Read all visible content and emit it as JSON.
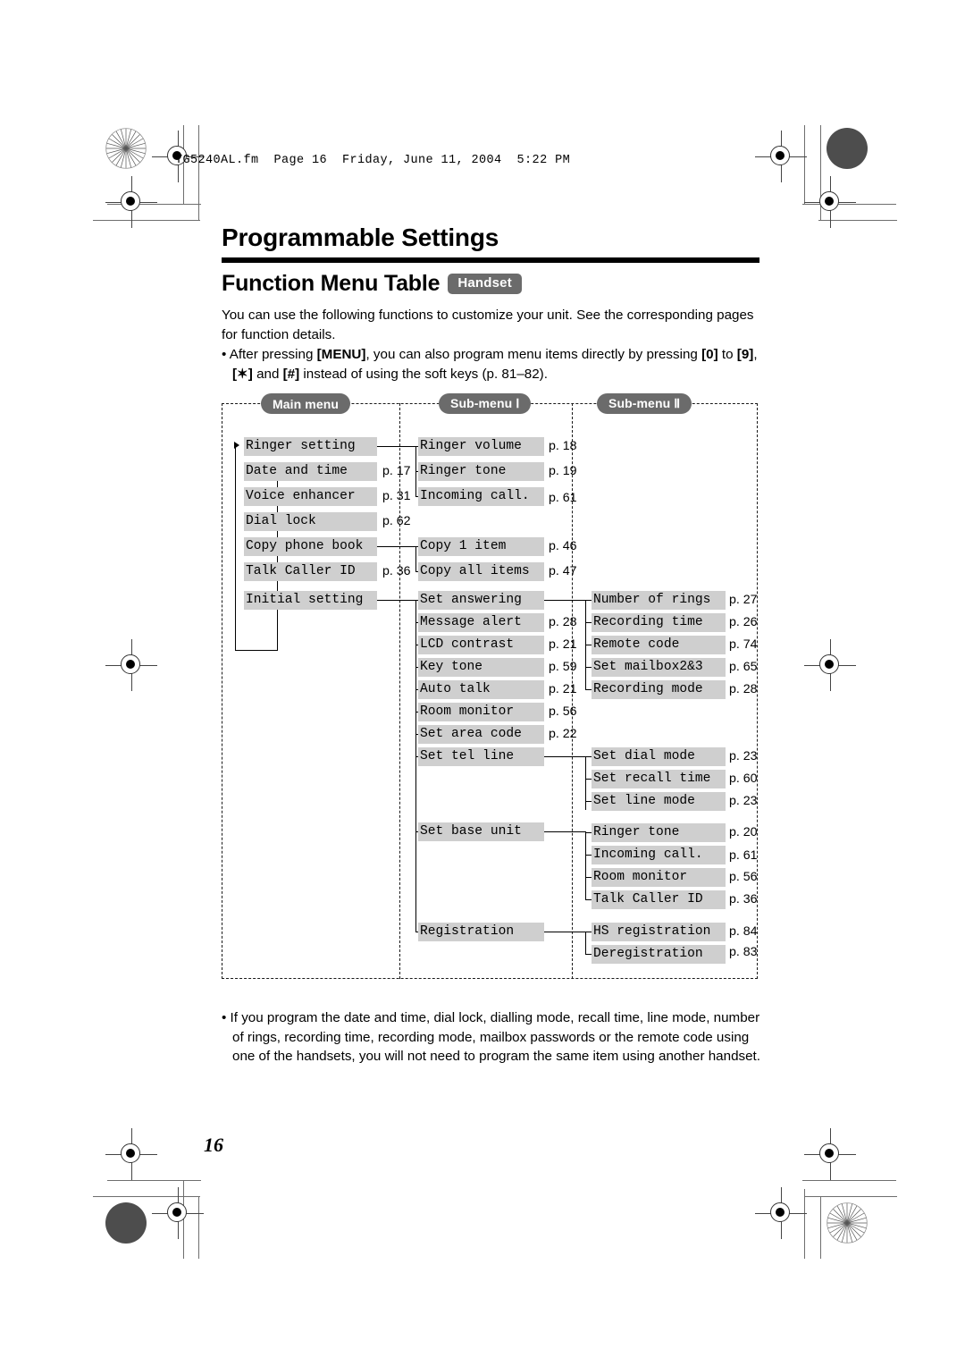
{
  "document": {
    "filename_header": "TG5240AL.fm  Page 16  Friday, June 11, 2004  5:22 PM",
    "page_number": "16"
  },
  "headings": {
    "chapter_title": "Programmable Settings",
    "section_title": "Function Menu Table",
    "section_badge": "Handset"
  },
  "intro": {
    "paragraph": "You can use the following functions to customize your unit. See the corresponding pages for function details.",
    "bullet_prefix": "• After pressing ",
    "key_menu": "[MENU]",
    "bullet_mid": ", you can also program menu items directly by pressing ",
    "key_0": "[0]",
    "bullet_to": " to ",
    "key_9": "[9]",
    "bullet_comma": ", ",
    "key_star": "[✶]",
    "bullet_and": " and ",
    "key_hash": "[#]",
    "bullet_tail": " instead of using the soft keys (p. 81–82)."
  },
  "footer": {
    "bullet": "• If you program the date and time, dial lock, dialling mode, recall time, line mode, number of rings, recording time, recording mode, mailbox passwords or the remote code using one of the handsets, you will not need to program the same item using another handset."
  },
  "diagram": {
    "columns": [
      {
        "label": "Main menu"
      },
      {
        "label": "Sub-menu Ⅰ"
      },
      {
        "label": "Sub-menu Ⅱ"
      }
    ],
    "main_menu": [
      {
        "label": "Ringer setting",
        "page": ""
      },
      {
        "label": "Date and time",
        "page": "p. 17"
      },
      {
        "label": "Voice enhancer",
        "page": "p. 31"
      },
      {
        "label": "Dial lock",
        "page": "p. 62"
      },
      {
        "label": "Copy phone book",
        "page": ""
      },
      {
        "label": "Talk Caller ID",
        "page": "p. 36"
      },
      {
        "label": "Initial setting",
        "page": ""
      }
    ],
    "sub_menu_1": [
      {
        "label": "Ringer volume",
        "page": "p. 18"
      },
      {
        "label": "Ringer tone",
        "page": "p. 19"
      },
      {
        "label": "Incoming call.",
        "page": "p. 61"
      },
      {
        "label": "Copy 1 item",
        "page": "p. 46"
      },
      {
        "label": "Copy all items",
        "page": "p. 47"
      },
      {
        "label": "Set answering",
        "page": ""
      },
      {
        "label": "Message alert",
        "page": "p. 28"
      },
      {
        "label": "LCD contrast",
        "page": "p. 21"
      },
      {
        "label": "Key tone",
        "page": "p. 59"
      },
      {
        "label": "Auto talk",
        "page": "p. 21"
      },
      {
        "label": "Room monitor",
        "page": "p. 56"
      },
      {
        "label": "Set area code",
        "page": "p. 22"
      },
      {
        "label": "Set tel line",
        "page": ""
      },
      {
        "label": "Set base unit",
        "page": ""
      },
      {
        "label": "Registration",
        "page": ""
      }
    ],
    "sub_menu_2": [
      {
        "label": "Number of rings",
        "page": "p. 27"
      },
      {
        "label": "Recording time",
        "page": "p. 26"
      },
      {
        "label": "Remote code",
        "page": "p. 74"
      },
      {
        "label": "Set mailbox2&3",
        "page": "p. 65"
      },
      {
        "label": "Recording mode",
        "page": "p. 28"
      },
      {
        "label": "Set dial mode",
        "page": "p. 23"
      },
      {
        "label": "Set recall time",
        "page": "p. 60"
      },
      {
        "label": "Set line mode",
        "page": "p. 23"
      },
      {
        "label": "Ringer tone",
        "page": "p. 20"
      },
      {
        "label": "Incoming call.",
        "page": "p. 61"
      },
      {
        "label": "Room monitor",
        "page": "p. 56"
      },
      {
        "label": "Talk Caller ID",
        "page": "p. 36"
      },
      {
        "label": "HS registration",
        "page": "p. 84"
      },
      {
        "label": "Deregistration",
        "page": "p. 83"
      }
    ]
  }
}
